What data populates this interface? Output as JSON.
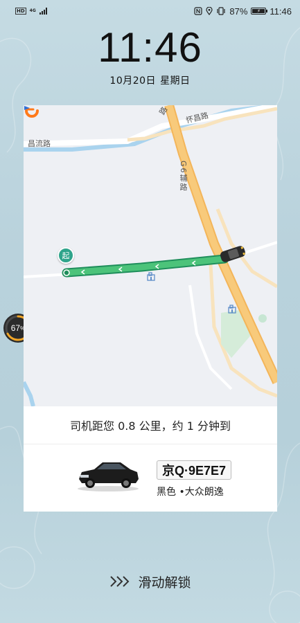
{
  "status_bar": {
    "hd": "HD",
    "network": "4G",
    "battery_percent": "87%",
    "battery_level": 0.87,
    "time": "11:46",
    "icons": [
      "nfc-icon",
      "location-icon",
      "vibrate-icon",
      "battery-icon"
    ]
  },
  "lock_screen": {
    "clock": "11:46",
    "date": "10月20日",
    "weekday": "星期日"
  },
  "map": {
    "labels": {
      "road_top": "路",
      "huaichang_road": "怀昌路",
      "changliu_road": "昌流路",
      "g6_aux_road": "G6辅路"
    },
    "start_marker": "起",
    "brand_icon": "didi-logo-icon",
    "route_color": "#3cb371",
    "highway_color": "#f5c06a"
  },
  "trip": {
    "info": "司机距您 0.8 公里，约 1 分钟到",
    "plate": "京Q·9E7E7",
    "car_description": "黑色 •大众朗逸"
  },
  "phone_battery_widget": {
    "value": "67",
    "unit": "%",
    "level": 0.67
  },
  "unlock": {
    "label": "滑动解锁"
  }
}
